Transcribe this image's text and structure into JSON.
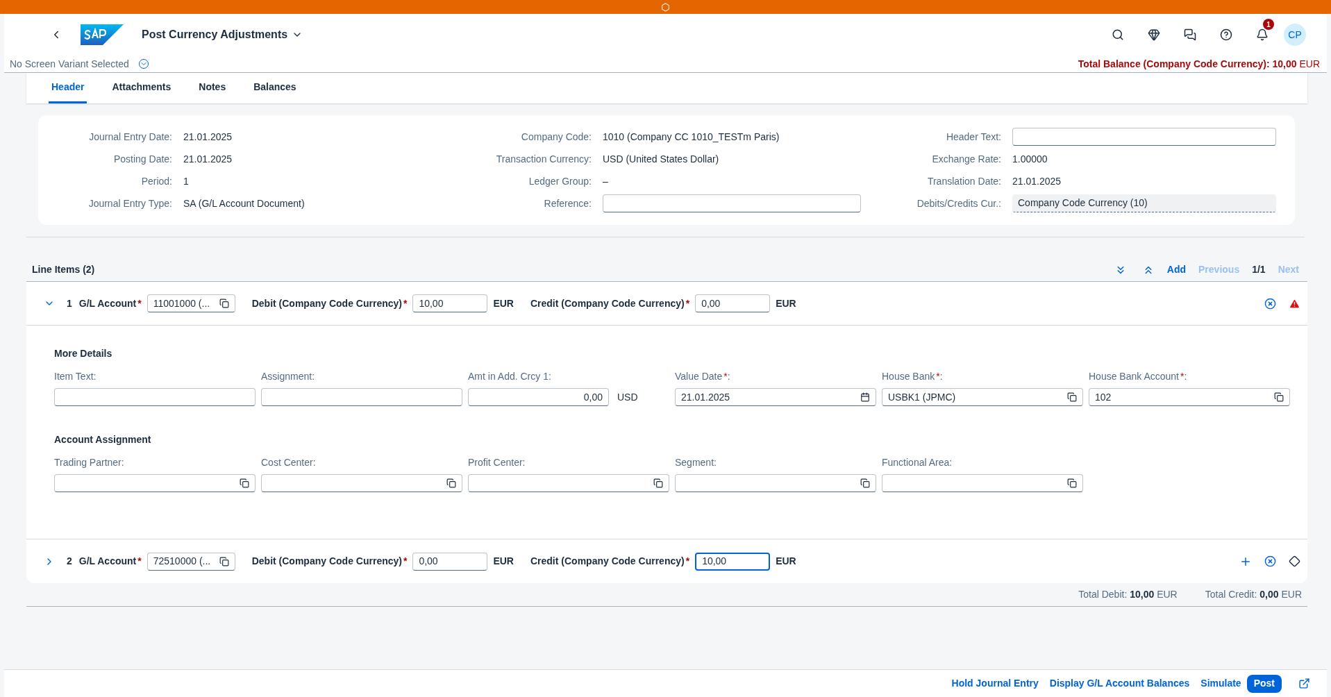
{
  "shell": {
    "title": "Post Currency Adjustments",
    "variant": "No Screen Variant Selected",
    "notification_count": "1",
    "avatar": "CP",
    "balance_label": "Total Balance (Company Code Currency):",
    "balance_value": "10,00",
    "balance_currency": "EUR"
  },
  "required_mark": "*",
  "tabs": [
    {
      "label": "Header",
      "selected": true
    },
    {
      "label": "Attachments",
      "selected": false
    },
    {
      "label": "Notes",
      "selected": false
    },
    {
      "label": "Balances",
      "selected": false
    }
  ],
  "header_columns": [
    [
      {
        "label": "Journal Entry Date:",
        "value": "21.01.2025",
        "kind": "text"
      },
      {
        "label": "Posting Date:",
        "value": "21.01.2025",
        "kind": "text"
      },
      {
        "label": "Period:",
        "value": "1",
        "kind": "text"
      },
      {
        "label": "Journal Entry Type:",
        "value": "SA (G/L Account Document)",
        "kind": "text"
      }
    ],
    [
      {
        "label": "Company Code:",
        "value": "1010 (Company CC 1010_TESTm Paris)",
        "kind": "text"
      },
      {
        "label": "Transaction Currency:",
        "value": "USD (United States Dollar)",
        "kind": "text"
      },
      {
        "label": "Ledger Group:",
        "value": "–",
        "kind": "text"
      },
      {
        "label": "Reference:",
        "kind": "input"
      }
    ],
    [
      {
        "label": "Header Text:",
        "kind": "input"
      },
      {
        "label": "Exchange Rate:",
        "value": "1.00000",
        "kind": "text"
      },
      {
        "label": "Translation Date:",
        "value": "21.01.2025",
        "kind": "text"
      },
      {
        "label": "Debits/Credits Cur.:",
        "value": "Company Code Currency (10)",
        "kind": "select"
      }
    ]
  ],
  "line_items": {
    "title": "Line Items (2)",
    "actions": [
      {
        "label": "Add",
        "disabled": false
      },
      {
        "label": "Previous",
        "disabled": true
      },
      {
        "label": "1/1",
        "kind": "page"
      },
      {
        "label": "Next",
        "disabled": true
      }
    ]
  },
  "items": [
    {
      "number": "1",
      "expanded": true,
      "account_label": "G/L Account",
      "account_value": "11001000 (...",
      "debit_label": "Debit (Company Code Currency)",
      "debit_value": "10,00",
      "debit_currency": "EUR",
      "debit_focused": false,
      "credit_label": "Credit (Company Code Currency)",
      "credit_value": "0,00",
      "credit_currency": "EUR",
      "credit_focused": false,
      "actions": [
        {
          "kind": "delete"
        },
        {
          "kind": "warning"
        }
      ],
      "sections": [
        {
          "title": "More Details",
          "fields": [
            {
              "label": "Item Text:",
              "required": false,
              "kind": "input"
            },
            {
              "label": "Assignment:",
              "required": false,
              "kind": "input"
            },
            {
              "label": "Amt in Add. Crcy 1:",
              "required": false,
              "kind": "amount",
              "value": "0,00",
              "unit": "USD"
            },
            {
              "label": "Value Date",
              "required": true,
              "after": ":",
              "kind": "date",
              "value": "21.01.2025"
            },
            {
              "label": "House Bank",
              "required": true,
              "after": ":",
              "kind": "valuehelp",
              "value": "USBK1 (JPMC)"
            },
            {
              "label": "House Bank Account",
              "required": true,
              "after": ":",
              "kind": "valuehelp",
              "value": "102"
            }
          ]
        },
        {
          "title": "Account Assignment",
          "fields": [
            {
              "label": "Trading Partner:",
              "required": false,
              "kind": "valuehelp"
            },
            {
              "label": "Cost Center:",
              "required": false,
              "kind": "valuehelp"
            },
            {
              "label": "Profit Center:",
              "required": false,
              "kind": "valuehelp"
            },
            {
              "label": "Segment:",
              "required": false,
              "kind": "valuehelp"
            },
            {
              "label": "Functional Area:",
              "required": false,
              "kind": "valuehelp"
            }
          ]
        }
      ]
    },
    {
      "number": "2",
      "expanded": false,
      "account_label": "G/L Account",
      "account_value": "72510000 (...",
      "debit_label": "Debit (Company Code Currency)",
      "debit_value": "0,00",
      "debit_currency": "EUR",
      "debit_focused": false,
      "credit_label": "Credit (Company Code Currency)",
      "credit_value": "10,00",
      "credit_currency": "EUR",
      "credit_focused": true,
      "actions": [
        {
          "kind": "add"
        },
        {
          "kind": "delete"
        },
        {
          "kind": "diamond"
        }
      ]
    }
  ],
  "totals": [
    {
      "label": "Total Debit:",
      "value": "10,00",
      "currency": "EUR"
    },
    {
      "label": "Total Credit:",
      "value": "0,00",
      "currency": "EUR"
    }
  ],
  "footer": [
    {
      "label": "Hold Journal Entry",
      "kind": "link"
    },
    {
      "label": "Display G/L Account Balances",
      "kind": "link"
    },
    {
      "label": "Simulate",
      "kind": "link"
    },
    {
      "label": "Post",
      "kind": "primary"
    },
    {
      "kind": "share"
    }
  ]
}
